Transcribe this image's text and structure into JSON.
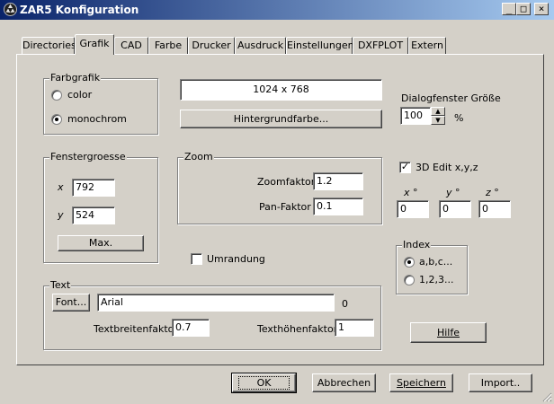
{
  "window": {
    "title": "ZAR5 Konfiguration",
    "btn_min": "_",
    "btn_max": "□",
    "btn_close": "×"
  },
  "tabs": [
    "Directories",
    "Grafik",
    "CAD",
    "Farbe",
    "Drucker",
    "Ausdruck",
    "Einstellungen",
    "DXFPLOT",
    "Extern"
  ],
  "farbgrafik": {
    "label": "Farbgrafik",
    "option_color": "color",
    "option_mono": "monochrom",
    "selected": "monochrom"
  },
  "resolution": "1024 x 768",
  "hintergrund_button": "Hintergrundfarbe...",
  "dialog": {
    "label": "Dialogfenster Größe",
    "value": "100",
    "unit": "%"
  },
  "fenster": {
    "label": "Fenstergroesse",
    "x_label": "x",
    "x_value": "792",
    "y_label": "y",
    "y_value": "524",
    "max_button": "Max."
  },
  "zoom": {
    "label": "Zoom",
    "zoomfaktor_label": "Zoomfaktor",
    "zoomfaktor_value": "1.2",
    "pan_label": "Pan-Faktor",
    "pan_value": "0.1"
  },
  "edit3d": {
    "label": "3D Edit x,y,z",
    "checked": true,
    "x_label": "x °",
    "y_label": "y °",
    "z_label": "z °",
    "x": "0",
    "y": "0",
    "z": "0"
  },
  "umrandung": {
    "label": "Umrandung",
    "checked": false
  },
  "index": {
    "label": "Index",
    "option1": "a,b,c...",
    "option2": "1,2,3...",
    "selected": "a,b,c..."
  },
  "text": {
    "label": "Text",
    "font_button": "Font...",
    "font_value": "Arial",
    "font_number": "0",
    "breite_label": "Textbreitenfaktor",
    "breite_value": "0.7",
    "hoehe_label": "Texthöhenfaktor",
    "hoehe_value": "1"
  },
  "hilfe_button": "Hilfe",
  "footer": {
    "ok": "OK",
    "abbrechen": "Abbrechen",
    "speichern": "Speichern",
    "import": "Import.."
  }
}
